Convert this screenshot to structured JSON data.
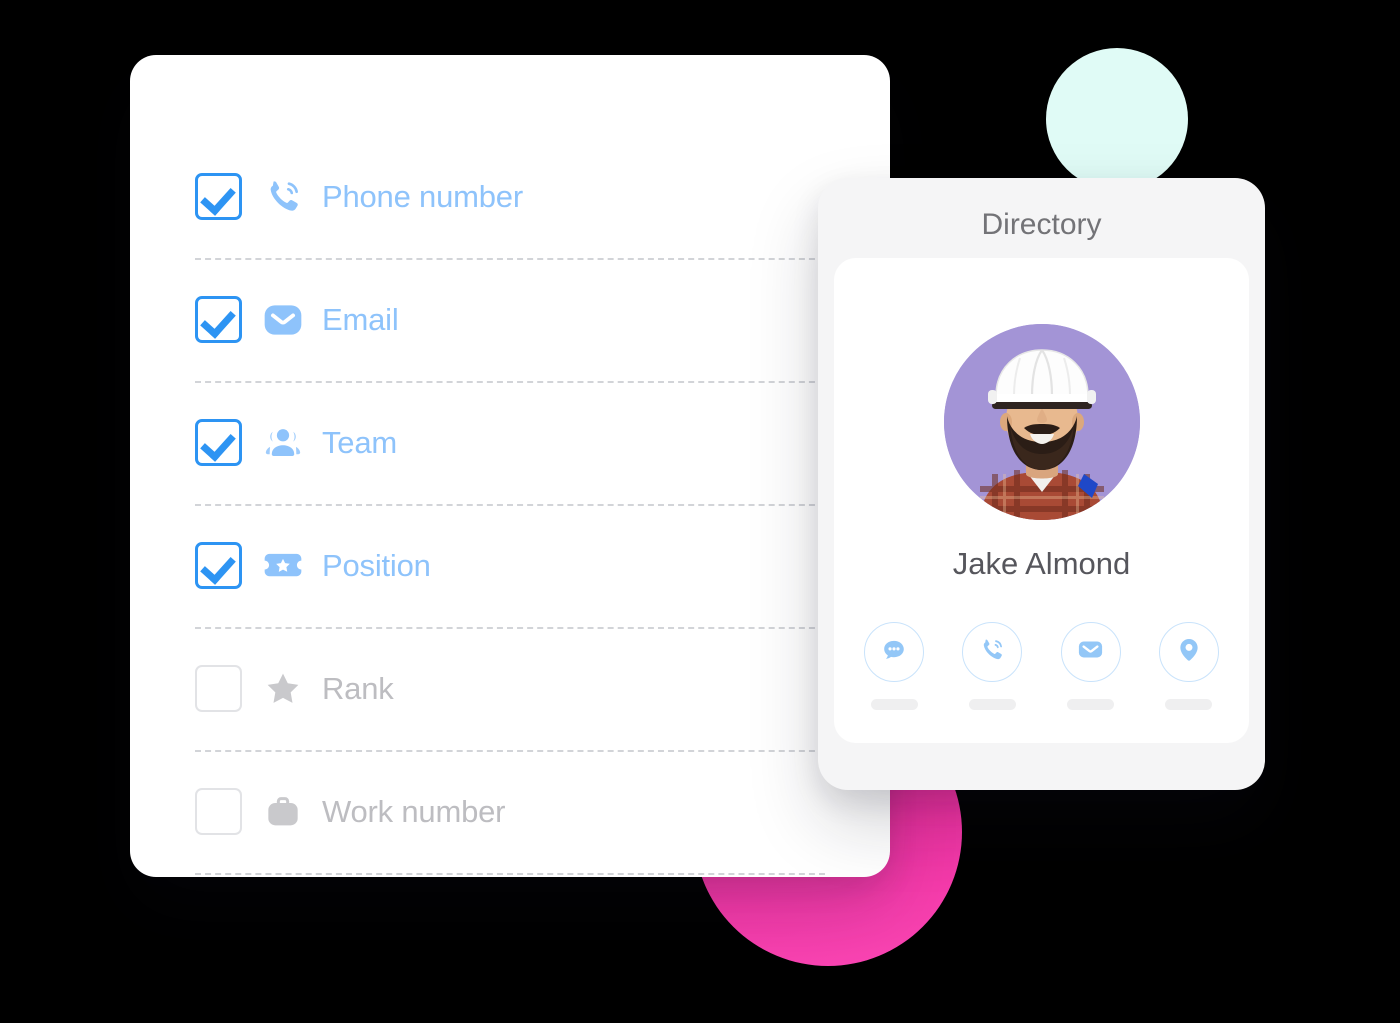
{
  "background_color": "#000000",
  "fields_panel": {
    "name": "contact-fields-list",
    "rows": [
      {
        "label": "Phone number",
        "icon": "phone-icon",
        "checked": true
      },
      {
        "label": "Email",
        "icon": "email-icon",
        "checked": true
      },
      {
        "label": "Team",
        "icon": "team-icon",
        "checked": true
      },
      {
        "label": "Position",
        "icon": "position-icon",
        "checked": true
      },
      {
        "label": "Rank",
        "icon": "star-icon",
        "checked": false
      },
      {
        "label": "Work number",
        "icon": "briefcase-icon",
        "checked": false
      }
    ],
    "colors": {
      "checked_label": "#8ec3fb",
      "unchecked_label": "#bdbdc1",
      "checkbox_accent": "#2d94f3",
      "separator": "#d2d4d8"
    }
  },
  "directory": {
    "title": "Directory",
    "profile": {
      "name": "Jake Almond",
      "avatar_alt": "bearded-man-in-white-hard-hat-and-plaid-shirt",
      "avatar_background": "#a394d6"
    },
    "actions": [
      {
        "icon": "chat-icon",
        "label": ""
      },
      {
        "icon": "phone-icon",
        "label": ""
      },
      {
        "icon": "email-icon",
        "label": ""
      },
      {
        "icon": "location-icon",
        "label": ""
      }
    ],
    "colors": {
      "card_background": "#f5f5f6",
      "inner_card_background": "#ffffff",
      "title": "#737377",
      "name": "#56565c",
      "action_ring": "#c9e3fb",
      "action_icon": "#93c7f7",
      "placeholder_bar": "#efeff0"
    }
  },
  "decorations": [
    {
      "name": "mint-circle",
      "color": "#e0fbf6"
    },
    {
      "name": "pink-circle",
      "color": "#ee2fa0"
    }
  ]
}
